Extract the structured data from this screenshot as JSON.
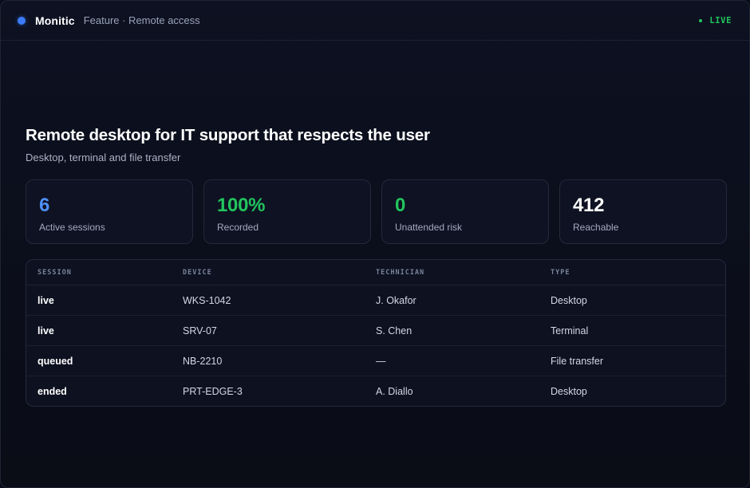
{
  "header": {
    "brand": "Monitic",
    "breadcrumb": "Feature · Remote access",
    "status": "LIVE"
  },
  "hero": {
    "title": "Remote desktop for IT support that respects the user",
    "subtitle": "Desktop, terminal and file transfer"
  },
  "stats": [
    {
      "value": "6",
      "label": "Active sessions",
      "color": "#4f8ff7"
    },
    {
      "value": "100%",
      "label": "Recorded",
      "color": "#22c55e"
    },
    {
      "value": "0",
      "label": "Unattended risk",
      "color": "#22c55e"
    },
    {
      "value": "412",
      "label": "Reachable",
      "color": "#ffffff"
    }
  ],
  "table": {
    "columns": [
      "SESSION",
      "DEVICE",
      "TECHNICIAN",
      "TYPE"
    ],
    "rows": [
      {
        "session": "live",
        "device": "WKS-1042",
        "technician": "J. Okafor",
        "type": "Desktop"
      },
      {
        "session": "live",
        "device": "SRV-07",
        "technician": "S. Chen",
        "type": "Terminal"
      },
      {
        "session": "queued",
        "device": "NB-2210",
        "technician": "—",
        "type": "File transfer"
      },
      {
        "session": "ended",
        "device": "PRT-EDGE-3",
        "technician": "A. Diallo",
        "type": "Desktop"
      }
    ]
  },
  "colors": {
    "accent": "#3b7bf6",
    "live": "#22c55e",
    "background": "#0b0e1a"
  }
}
